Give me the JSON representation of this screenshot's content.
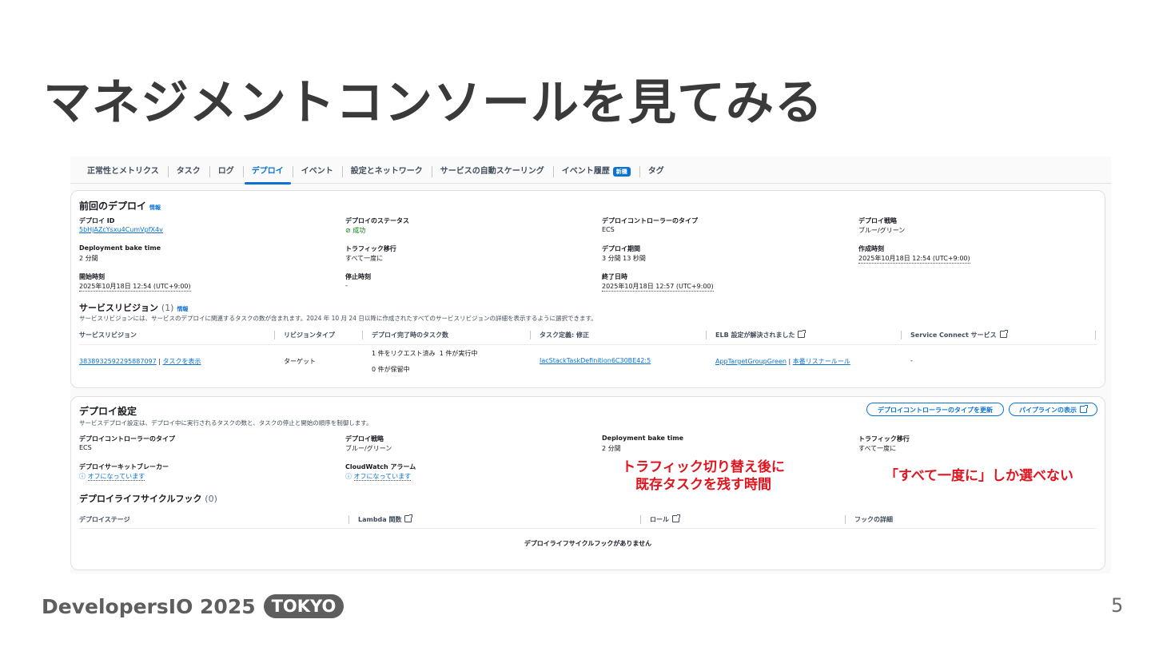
{
  "slide": {
    "title": "マネジメントコンソールを見てみる",
    "footer_brand": "DevelopersIO 2025",
    "footer_badge": "TOKYO",
    "page_number": "5"
  },
  "tabs": [
    {
      "label": "正常性とメトリクス"
    },
    {
      "label": "タスク"
    },
    {
      "label": "ログ"
    },
    {
      "label": "デプロイ",
      "active": true
    },
    {
      "label": "イベント"
    },
    {
      "label": "設定とネットワーク"
    },
    {
      "label": "サービスの自動スケーリング"
    },
    {
      "label": "イベント履歴",
      "badge": "新機"
    },
    {
      "label": "タグ"
    }
  ],
  "last_deploy": {
    "title": "前回のデプロイ",
    "info": "情報",
    "fields": [
      {
        "label": "デプロイ ID",
        "value": "5bHjAZcYsxu4CumVpfX4v"
      },
      {
        "label": "デプロイのステータス",
        "value": "成功"
      },
      {
        "label": "デプロイコントローラーのタイプ",
        "value": "ECS"
      },
      {
        "label": "デプロイ戦略",
        "value": "ブルー/グリーン"
      },
      {
        "label": "Deployment bake time",
        "value": "2 分間"
      },
      {
        "label": "トラフィック移行",
        "value": "すべて一度に"
      },
      {
        "label": "デプロイ期間",
        "value": "3 分間 13 秒間"
      },
      {
        "label": "作成時刻",
        "value": "2025年10月18日 12:54 (UTC+9:00)"
      },
      {
        "label": "開始時刻",
        "value": "2025年10月18日 12:54 (UTC+9:00)"
      },
      {
        "label": "停止時刻",
        "value": "-"
      },
      {
        "label": "終了日時",
        "value": "2025年10月18日 12:57 (UTC+9:00)"
      }
    ]
  },
  "revisions": {
    "title": "サービスリビジョン",
    "count": "(1)",
    "info": "情報",
    "description": "サービスリビジョンには、サービスのデプロイに関連するタスクの数が含まれます。2024 年 10 月 24 日以降に作成されたすべてのサービスリビジョンの詳細を表示するように選択できます。",
    "columns": [
      "サービスリビジョン",
      "リビジョンタイプ",
      "デプロイ完了時のタスク数",
      "タスク定義: 修正",
      "ELB 設定が解決されました",
      "Service Connect サービス"
    ],
    "row": {
      "revision_id": "3838932592295887097",
      "sep": "|",
      "view_tasks": "タスクを表示",
      "type": "ターゲット",
      "tasks_line1": "1 件をリクエスト済み",
      "tasks_line1b": "1 件が実行中",
      "tasks_line2": "0 件が保留中",
      "task_def": "IacStackTaskDefinition6C30BE42:5",
      "elb_target": "AppTargetGroupGreen",
      "elb_rule": "本番リスナールール",
      "service_connect": "-"
    }
  },
  "deploy_settings": {
    "title": "デプロイ設定",
    "description": "サービスデプロイ設定は、デプロイ中に実行されるタスクの数と、タスクの停止と開始の順序を制御します。",
    "update_button": "デプロイコントローラーのタイプを更新",
    "pipeline_button": "パイプラインの表示",
    "fields": [
      {
        "label": "デプロイコントローラーのタイプ",
        "value": "ECS"
      },
      {
        "label": "デプロイ戦略",
        "value": "ブルー/グリーン"
      },
      {
        "label": "Deployment bake time",
        "value": "2 分間"
      },
      {
        "label": "トラフィック移行",
        "value": "すべて一度に"
      },
      {
        "label": "デプロイサーキットブレーカー",
        "value": "オフになっています"
      },
      {
        "label": "CloudWatch アラーム",
        "value": "オフになっています"
      }
    ],
    "hooks_title": "デプロイライフサイクルフック",
    "hooks_count": "(0)",
    "hook_columns": [
      "デプロイステージ",
      "Lambda 関数",
      "ロール",
      "フックの詳細"
    ],
    "empty": "デプロイライフサイクルフックがありません"
  },
  "annotations": {
    "bake_line1": "トラフィック切り替え後に",
    "bake_line2": "既存タスクを残す時間",
    "traffic": "「すべて一度に」しか選べない"
  },
  "colors": {
    "accent": "#0972d3",
    "success": "#037f0c",
    "annotation": "#e0141e"
  }
}
